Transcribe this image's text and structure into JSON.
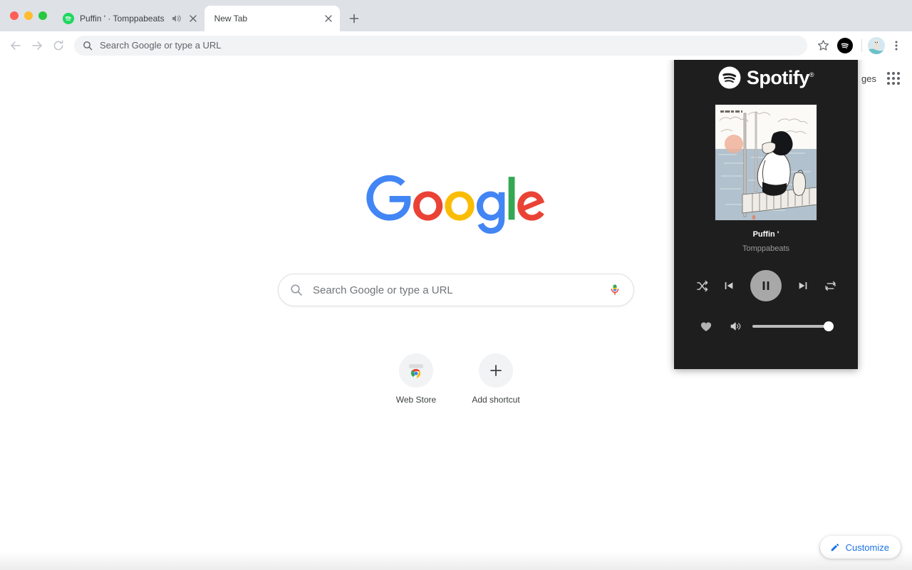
{
  "window": {
    "traffic_lights": [
      "close",
      "minimize",
      "zoom"
    ]
  },
  "tabs": [
    {
      "title": "Puffin ' · Tomppabeats",
      "favicon": "spotify-icon",
      "audio_state": "playing",
      "active": false
    },
    {
      "title": "New Tab",
      "favicon": "none",
      "audio_state": "none",
      "active": true
    }
  ],
  "tabstrip": {
    "new_tab_label": "+"
  },
  "toolbar": {
    "back_icon": "back-arrow-icon",
    "forward_icon": "forward-arrow-icon",
    "reload_icon": "reload-icon",
    "omnibox_placeholder": "Search Google or type a URL",
    "omnibox_value": "",
    "bookmark_icon": "star-icon",
    "extension_icon": "spotify-extension-icon",
    "profile_icon": "avatar",
    "menu_icon": "three-dot-menu-icon"
  },
  "new_tab_page": {
    "gmail_link": "ges",
    "apps_grid_icon": "apps-grid-icon",
    "logo_text": "Google",
    "logo_colors": {
      "blue": "#4285f4",
      "red": "#ea4335",
      "yellow": "#fbbc05",
      "green": "#34a853"
    },
    "search_placeholder": "Search Google or type a URL",
    "search_icon": "search-icon",
    "mic_icon": "microphone-icon",
    "shortcuts": [
      {
        "label": "Web Store",
        "icon": "chrome-web-store-icon"
      },
      {
        "label": "Add shortcut",
        "icon": "plus-icon"
      }
    ],
    "customize": {
      "label": "Customize",
      "icon": "pencil-icon",
      "accent": "#1a73e8"
    }
  },
  "spotify_popup": {
    "brand": "Spotify",
    "brand_registered": "®",
    "brand_icon": "spotify-logo-icon",
    "album_art_alt": "Person sitting on a pier at sunset, manga illustration",
    "album_art_corner_text": "",
    "track": "Puffin '",
    "artist": "Tomppabeats",
    "controls": {
      "shuffle": "shuffle-icon",
      "previous": "previous-track-icon",
      "play_pause": "pause-icon",
      "play_state": "playing",
      "next": "next-track-icon",
      "repeat": "repeat-icon"
    },
    "bottom": {
      "like": "heart-icon",
      "liked": false,
      "volume_icon": "speaker-icon",
      "volume_percent": 100
    },
    "background_color": "#1e1e1e"
  }
}
